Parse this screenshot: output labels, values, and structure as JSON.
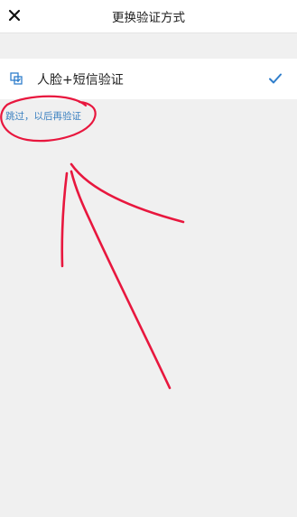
{
  "header": {
    "close_icon": "close-icon",
    "title": "更换验证方式"
  },
  "options": [
    {
      "icon": "face-scan-icon",
      "label": "人脸+短信验证",
      "selected": true,
      "check_icon": "checkmark-icon"
    }
  ],
  "skip_link": "跳过，以后再验证",
  "colors": {
    "accent": "#2f7ecb",
    "link": "#3a80c0",
    "annotation": "#e8173e",
    "background": "#f0f0f0"
  }
}
